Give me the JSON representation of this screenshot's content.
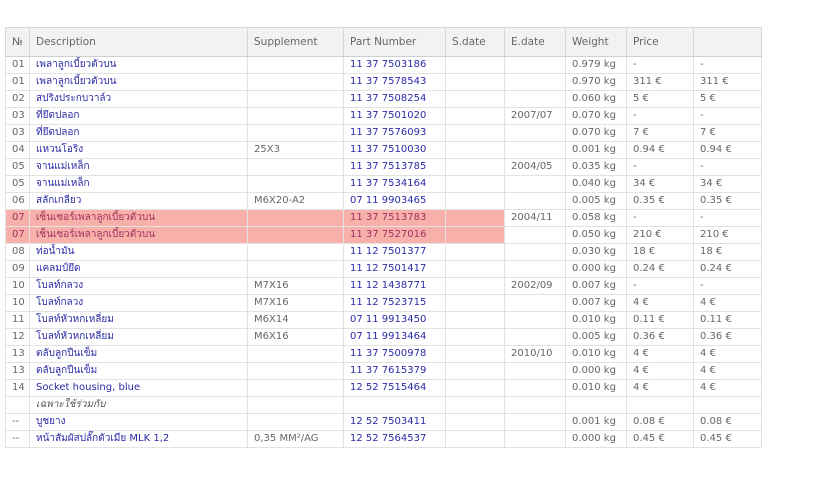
{
  "columns": [
    "№",
    "Description",
    "Supplement",
    "Part Number",
    "S.date",
    "E.date",
    "Weight",
    "Price",
    ""
  ],
  "rows": [
    {
      "no": "01",
      "desc": "เพลาลูกเบี้ยวตัวบน",
      "supp": "",
      "pn": "11 37 7503186",
      "sdate": "",
      "edate": "",
      "weight": "0.979 kg",
      "price": "-",
      "price2": "-",
      "hl": false,
      "link": true
    },
    {
      "no": "01",
      "desc": "เพลาลูกเบี้ยวตัวบน",
      "supp": "",
      "pn": "11 37 7578543",
      "sdate": "",
      "edate": "",
      "weight": "0.970 kg",
      "price": "311 €",
      "price2": "311 €",
      "hl": false,
      "link": true
    },
    {
      "no": "02",
      "desc": "สปริงประกบวาล์ว",
      "supp": "",
      "pn": "11 37 7508254",
      "sdate": "",
      "edate": "",
      "weight": "0.060 kg",
      "price": "5 €",
      "price2": "5 €",
      "hl": false,
      "link": true
    },
    {
      "no": "03",
      "desc": "ที่ยึดปลอก",
      "supp": "",
      "pn": "11 37 7501020",
      "sdate": "",
      "edate": "2007/07",
      "weight": "0.070 kg",
      "price": "-",
      "price2": "-",
      "hl": false,
      "link": true
    },
    {
      "no": "03",
      "desc": "ที่ยึดปลอก",
      "supp": "",
      "pn": "11 37 7576093",
      "sdate": "",
      "edate": "",
      "weight": "0.070 kg",
      "price": "7 €",
      "price2": "7 €",
      "hl": false,
      "link": true
    },
    {
      "no": "04",
      "desc": "แหวนโอริง",
      "supp": "25X3",
      "pn": "11 37 7510030",
      "sdate": "",
      "edate": "",
      "weight": "0.001 kg",
      "price": "0.94 €",
      "price2": "0.94 €",
      "hl": false,
      "link": true
    },
    {
      "no": "05",
      "desc": "จานแม่เหล็ก",
      "supp": "",
      "pn": "11 37 7513785",
      "sdate": "",
      "edate": "2004/05",
      "weight": "0.035 kg",
      "price": "-",
      "price2": "-",
      "hl": false,
      "link": true
    },
    {
      "no": "05",
      "desc": "จานแม่เหล็ก",
      "supp": "",
      "pn": "11 37 7534164",
      "sdate": "",
      "edate": "",
      "weight": "0.040 kg",
      "price": "34 €",
      "price2": "34 €",
      "hl": false,
      "link": true
    },
    {
      "no": "06",
      "desc": "สลักเกลียว",
      "supp": "M6X20-A2",
      "pn": "07 11 9903465",
      "sdate": "",
      "edate": "",
      "weight": "0.005 kg",
      "price": "0.35 €",
      "price2": "0.35 €",
      "hl": false,
      "link": true
    },
    {
      "no": "07",
      "desc": "เซ็นเซอร์เพลาลูกเบี้ยวตัวบน",
      "supp": "",
      "pn": "11 37 7513783",
      "sdate": "",
      "edate": "2004/11",
      "weight": "0.058 kg",
      "price": "-",
      "price2": "-",
      "hl": true,
      "link": true
    },
    {
      "no": "07",
      "desc": "เซ็นเซอร์เพลาลูกเบี้ยวตัวบน",
      "supp": "",
      "pn": "11 37 7527016",
      "sdate": "",
      "edate": "",
      "weight": "0.050 kg",
      "price": "210 €",
      "price2": "210 €",
      "hl": true,
      "link": true
    },
    {
      "no": "08",
      "desc": "ท่อน้ำมัน",
      "supp": "",
      "pn": "11 12 7501377",
      "sdate": "",
      "edate": "",
      "weight": "0.030 kg",
      "price": "18 €",
      "price2": "18 €",
      "hl": false,
      "link": true
    },
    {
      "no": "09",
      "desc": "แคลมป์ยึด",
      "supp": "",
      "pn": "11 12 7501417",
      "sdate": "",
      "edate": "",
      "weight": "0.000 kg",
      "price": "0.24 €",
      "price2": "0.24 €",
      "hl": false,
      "link": true
    },
    {
      "no": "10",
      "desc": "โบลท์กลวง",
      "supp": "M7X16",
      "pn": "11 12 1438771",
      "sdate": "",
      "edate": "2002/09",
      "weight": "0.007 kg",
      "price": "-",
      "price2": "-",
      "hl": false,
      "link": true
    },
    {
      "no": "10",
      "desc": "โบลท์กลวง",
      "supp": "M7X16",
      "pn": "11 12 7523715",
      "sdate": "",
      "edate": "",
      "weight": "0.007 kg",
      "price": "4 €",
      "price2": "4 €",
      "hl": false,
      "link": true
    },
    {
      "no": "11",
      "desc": "โบลท์หัวหกเหลี่ยม",
      "supp": "M6X14",
      "pn": "07 11 9913450",
      "sdate": "",
      "edate": "",
      "weight": "0.010 kg",
      "price": "0.11 €",
      "price2": "0.11 €",
      "hl": false,
      "link": true
    },
    {
      "no": "12",
      "desc": "โบลท์หัวหกเหลี่ยม",
      "supp": "M6X16",
      "pn": "07 11 9913464",
      "sdate": "",
      "edate": "",
      "weight": "0.005 kg",
      "price": "0.36 €",
      "price2": "0.36 €",
      "hl": false,
      "link": true
    },
    {
      "no": "13",
      "desc": "ตลับลูกปืนเข็ม",
      "supp": "",
      "pn": "11 37 7500978",
      "sdate": "",
      "edate": "2010/10",
      "weight": "0.010 kg",
      "price": "4 €",
      "price2": "4 €",
      "hl": false,
      "link": true
    },
    {
      "no": "13",
      "desc": "ตลับลูกปืนเข็ม",
      "supp": "",
      "pn": "11 37 7615379",
      "sdate": "",
      "edate": "",
      "weight": "0.000 kg",
      "price": "4 €",
      "price2": "4 €",
      "hl": false,
      "link": true
    },
    {
      "no": "14",
      "desc": "Socket housing, blue",
      "supp": "",
      "pn": "12 52 7515464",
      "sdate": "",
      "edate": "",
      "weight": "0.010 kg",
      "price": "4 €",
      "price2": "4 €",
      "hl": false,
      "link": true
    },
    {
      "no": "",
      "desc": "เฉพาะใช้ร่วมกับ",
      "supp": "",
      "pn": "",
      "sdate": "",
      "edate": "",
      "weight": "",
      "price": "",
      "price2": "",
      "hl": false,
      "link": false,
      "italic": true
    },
    {
      "no": "--",
      "desc": "บูชยาง",
      "supp": "",
      "pn": "12 52 7503411",
      "sdate": "",
      "edate": "",
      "weight": "0.001 kg",
      "price": "0.08 €",
      "price2": "0.08 €",
      "hl": false,
      "link": true
    },
    {
      "no": "--",
      "desc": "หน้าสัมผัสปลั๊กตัวเมีย MLK 1,2",
      "supp": "0,35 MM²/AG",
      "pn": "12 52 7564537",
      "sdate": "",
      "edate": "",
      "weight": "0.000 kg",
      "price": "0.45 €",
      "price2": "0.45 €",
      "hl": false,
      "link": true
    }
  ]
}
